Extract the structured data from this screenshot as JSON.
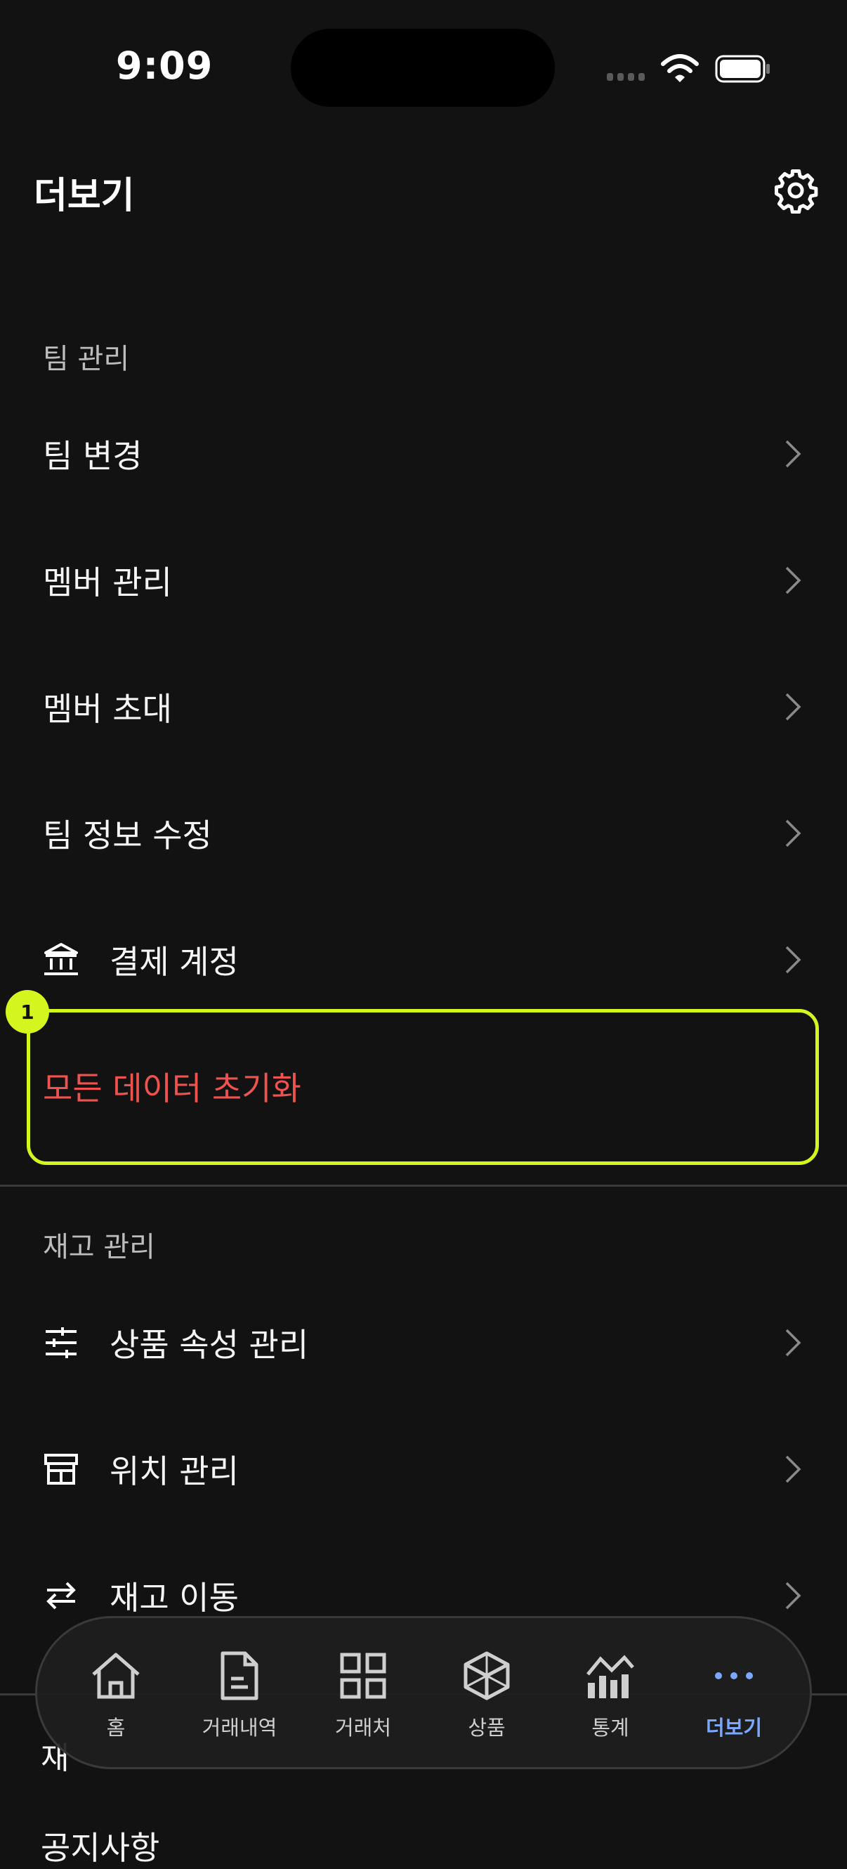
{
  "status_bar": {
    "time": "9:09"
  },
  "header": {
    "title": "더보기"
  },
  "sections": {
    "team": {
      "title": "팀 관리",
      "items": [
        {
          "label": "팀 변경"
        },
        {
          "label": "멤버 관리"
        },
        {
          "label": "멤버 초대"
        },
        {
          "label": "팀 정보 수정"
        },
        {
          "label": "결제 계정",
          "icon": "bank-icon"
        },
        {
          "label": "모든 데이터 초기화"
        }
      ]
    },
    "inventory": {
      "title": "재고 관리",
      "items": [
        {
          "label": "상품 속성 관리",
          "icon": "sliders-icon"
        },
        {
          "label": "위치 관리",
          "icon": "store-icon"
        },
        {
          "label": "재고 이동",
          "icon": "transfer-icon"
        }
      ]
    }
  },
  "peek": {
    "section_partial": "재",
    "item_partial": "공지사항"
  },
  "highlight": {
    "badge_number": "1"
  },
  "bottom_nav": {
    "items": [
      {
        "label": "홈",
        "icon": "home-icon"
      },
      {
        "label": "거래내역",
        "icon": "document-icon"
      },
      {
        "label": "거래처",
        "icon": "grid-icon"
      },
      {
        "label": "상품",
        "icon": "cube-icon"
      },
      {
        "label": "통계",
        "icon": "chart-icon"
      },
      {
        "label": "더보기",
        "icon": "more-icon",
        "active": true
      }
    ]
  },
  "colors": {
    "background": "#121212",
    "danger": "#ef5350",
    "highlight": "#d4f51d",
    "active_tab": "#7aa8ff"
  }
}
